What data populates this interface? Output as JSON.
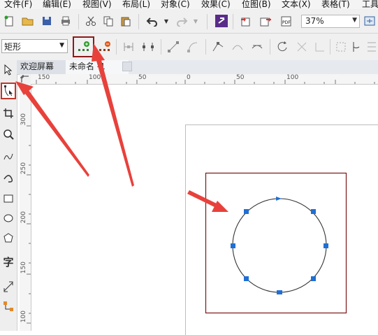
{
  "menu": {
    "items": [
      "文件(F)",
      "编辑(E)",
      "视图(V)",
      "布局(L)",
      "对象(C)",
      "效果(C)",
      "位图(B)",
      "文本(X)",
      "表格(T)",
      "工具"
    ]
  },
  "toolbar": {
    "zoom": "37%",
    "icons": [
      "new-icon",
      "open-icon",
      "save-icon",
      "print-icon",
      "cut-icon",
      "copy-icon",
      "paste-icon",
      "undo-icon",
      "redo-icon",
      "search-content-icon",
      "import-icon",
      "export-icon",
      "publish-pdf-icon",
      "zoom-icon",
      "full-screen-icon"
    ]
  },
  "property_bar": {
    "shape_selector": "矩形",
    "icons": [
      "add-node-icon",
      "delete-node-icon",
      "join-nodes-icon",
      "break-curve-icon",
      "to-line-icon",
      "to-curve-icon",
      "cusp-node-icon",
      "smooth-node-icon",
      "symmetrical-node-icon",
      "reverse-direction-icon",
      "extend-curve-icon",
      "extract-subpath-icon",
      "stretch-nodes-icon",
      "rotate-nodes-icon",
      "align-nodes-icon",
      "select-all-nodes-icon"
    ]
  },
  "tabs": {
    "welcome": "欢迎屏幕",
    "untitled": "未命名 -1"
  },
  "rulers": {
    "horizontal": [
      "150",
      "100",
      "50",
      "0",
      "50",
      "100"
    ],
    "vertical": [
      "300",
      "250",
      "200",
      "150",
      "100"
    ]
  },
  "toolbox": {
    "text_tool": "字"
  },
  "colors": {
    "selection_box": "#7a1515",
    "node_handle": "#1f6fd6",
    "annotation_arrow": "#e8413b"
  }
}
